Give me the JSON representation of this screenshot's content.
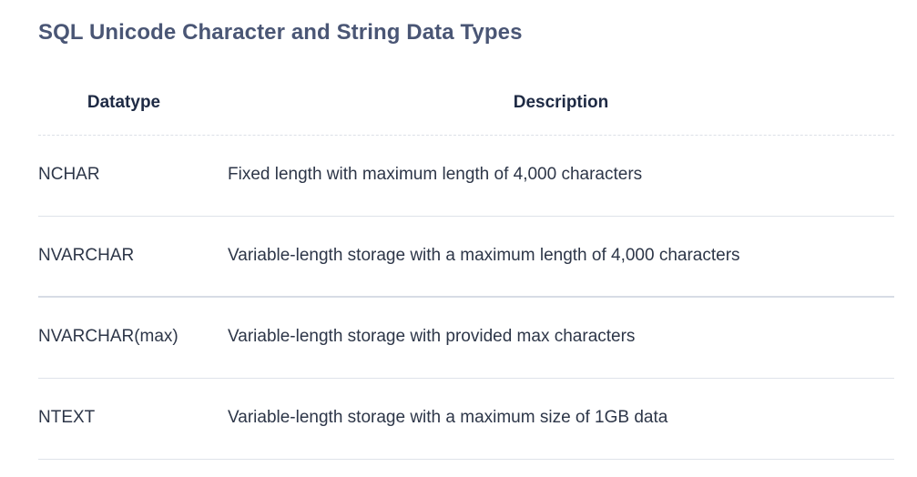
{
  "title": "SQL Unicode Character and String Data Types",
  "table": {
    "headers": {
      "datatype": "Datatype",
      "description": "Description"
    },
    "rows": [
      {
        "datatype": "NCHAR",
        "description": "Fixed length with maximum length of 4,000 characters"
      },
      {
        "datatype": "NVARCHAR",
        "description": "Variable-length storage with a maximum length of 4,000 characters"
      },
      {
        "datatype": "NVARCHAR(max)",
        "description": "Variable-length storage with provided max characters"
      },
      {
        "datatype": "NTEXT",
        "description": "Variable-length storage with a maximum size of 1GB data"
      }
    ]
  }
}
